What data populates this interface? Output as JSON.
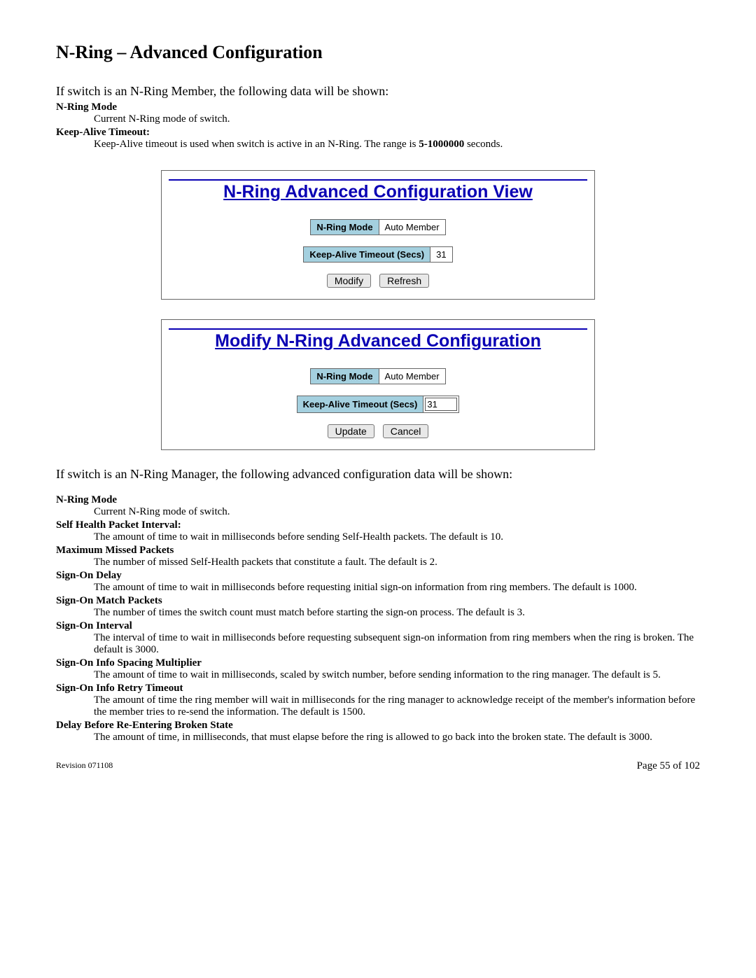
{
  "title": "N-Ring – Advanced Configuration",
  "intro": "If switch is an N-Ring Member, the following data will be shown:",
  "memberDefs": {
    "mode_term": "N-Ring Mode",
    "mode_desc": "Current N-Ring mode of switch.",
    "ka_term": "Keep-Alive Timeout:",
    "ka_desc_pre": "Keep-Alive timeout is used when switch is active in an N-Ring. The range is ",
    "ka_range": "5-1000000",
    "ka_desc_post": " seconds."
  },
  "viewPanel": {
    "title": "N-Ring Advanced Configuration View",
    "mode_label": "N-Ring Mode",
    "mode_value": "Auto Member",
    "ka_label": "Keep-Alive Timeout (Secs)",
    "ka_value": "31",
    "modify": "Modify",
    "refresh": "Refresh"
  },
  "modifyPanel": {
    "title": "Modify N-Ring Advanced Configuration",
    "mode_label": "N-Ring Mode",
    "mode_value": "Auto Member",
    "ka_label": "Keep-Alive Timeout (Secs)",
    "ka_value": "31",
    "update": "Update",
    "cancel": "Cancel"
  },
  "manager_intro": "If switch is an N-Ring Manager, the following advanced configuration data will be shown:",
  "managerDefs": [
    {
      "term": "N-Ring Mode",
      "desc": "Current N-Ring mode of switch."
    },
    {
      "term": "Self Health Packet Interval:",
      "desc": "The amount of time to wait in milliseconds before sending Self-Health packets. The default is 10."
    },
    {
      "term": "Maximum Missed Packets",
      "desc": "The number of missed Self-Health packets that constitute a fault. The default is 2."
    },
    {
      "term": "Sign-On Delay",
      "desc": "The amount of time to wait in milliseconds before requesting initial sign-on information from ring members. The default is 1000."
    },
    {
      "term": "Sign-On Match Packets",
      "desc": "The number of times the switch count must match before starting the sign-on process. The default is 3."
    },
    {
      "term": "Sign-On Interval",
      "desc": "The interval of time to wait in milliseconds before requesting subsequent sign-on information from ring members when the ring is broken. The default is 3000."
    },
    {
      "term": "Sign-On Info Spacing Multiplier",
      "desc": "The amount of time to wait in milliseconds, scaled by switch number, before sending information to the ring manager. The default is 5."
    },
    {
      "term": "Sign-On Info Retry Timeout",
      "desc": "The amount of time the ring member will wait in milliseconds for the ring manager to acknowledge receipt of the member's information before the member tries to re-send the information. The default is 1500."
    },
    {
      "term": "Delay Before Re-Entering Broken State",
      "desc": "The amount of time, in milliseconds, that must elapse before the ring is allowed to go back into the broken state. The default is 3000."
    }
  ],
  "footer": {
    "revision": "Revision 071108",
    "page": "Page 55 of 102"
  }
}
